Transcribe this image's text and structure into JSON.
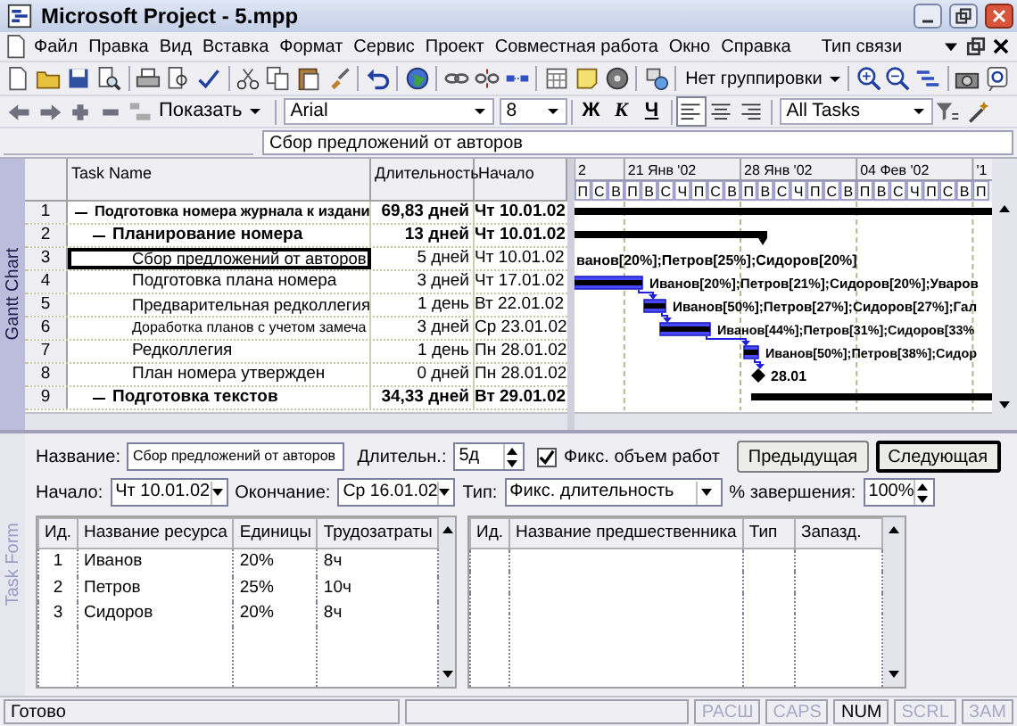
{
  "window": {
    "title": "Microsoft Project - 5.mpp"
  },
  "menu": {
    "items": [
      {
        "label": "Файл"
      },
      {
        "label": "Правка"
      },
      {
        "label": "Вид"
      },
      {
        "label": "Вставка"
      },
      {
        "label": "Формат"
      },
      {
        "label": "Сервис"
      },
      {
        "label": "Проект"
      },
      {
        "label": "Совместная работа"
      },
      {
        "label": "Окно"
      },
      {
        "label": "Справка"
      }
    ],
    "hint": "Тип связи"
  },
  "toolbar": {
    "grouping": "Нет группировки",
    "show": "Показать",
    "font": "Arial",
    "font_size": "8",
    "bold": "Ж",
    "italic": "К",
    "underline": "Ч",
    "align": [
      {
        "selected": true
      },
      {
        "selected": false
      },
      {
        "selected": false
      }
    ],
    "filter": "All Tasks"
  },
  "entry_bar": {
    "value": "Сбор предложений от авторов"
  },
  "gantt": {
    "view_label": "Gantt Chart",
    "columns": [
      "Task Name",
      "Длительность",
      "Начало"
    ],
    "timescale": {
      "weeks": [
        "2",
        "21 Янв '02",
        "28 Янв '02",
        "04 Фев '02",
        "'1"
      ],
      "days": [
        "П",
        "С",
        "В",
        "П",
        "В",
        "С",
        "Ч",
        "П",
        "С",
        "В",
        "П",
        "В",
        "С",
        "Ч",
        "П",
        "С",
        "В",
        "П",
        "В",
        "С",
        "Ч",
        "П",
        "С",
        "В",
        "П"
      ]
    },
    "tasks": [
      {
        "id": "1",
        "name": "Подготовка номера журнала к издани",
        "duration": "69,83 дней",
        "start": "Чт 10.01.02",
        "kind": "summary",
        "expanded": true,
        "selected": false,
        "children": [
          {
            "id": "2",
            "name": "Планирование номера",
            "duration": "13 дней",
            "start": "Чт 10.01.02",
            "kind": "summary",
            "expanded": true,
            "selected": false,
            "children": [
              {
                "id": "3",
                "name": "Сбор предложений от авторов",
                "duration": "5 дней",
                "start": "Чт 10.01.02",
                "kind": "task",
                "selected": true,
                "bar_label": "ванов[20%];Петров[25%];Сидоров[20%]"
              },
              {
                "id": "4",
                "name": "Подготовка плана номера",
                "duration": "3 дней",
                "start": "Чт 17.01.02",
                "kind": "task",
                "selected": false,
                "bar_label": "Иванов[20%];Петров[21%];Сидоров[20%];Уваров"
              },
              {
                "id": "5",
                "name": "Предварительная редколлегия",
                "duration": "1 день",
                "start": "Вт 22.01.02",
                "kind": "task",
                "selected": false,
                "bar_label": "Иванов[50%];Петров[27%];Сидоров[27%];Гал"
              },
              {
                "id": "6",
                "name": "Доработка планов с учетом замеча",
                "duration": "3 дней",
                "start": "Ср 23.01.02",
                "kind": "task",
                "selected": false,
                "bar_label": "Иванов[44%];Петров[31%];Сидоров[33%"
              },
              {
                "id": "7",
                "name": "Редколлегия",
                "duration": "1 день",
                "start": "Пн 28.01.02",
                "kind": "task",
                "selected": false,
                "bar_label": "Иванов[50%];Петров[38%];Сидор"
              },
              {
                "id": "8",
                "name": "План номера утвержден",
                "duration": "0 дней",
                "start": "Пн 28.01.02",
                "kind": "milestone",
                "selected": false,
                "bar_label": "28.01"
              }
            ]
          },
          {
            "id": "9",
            "name": "Подготовка текстов",
            "duration": "34,33 дней",
            "start": "Вт 29.01.02",
            "kind": "summary",
            "expanded": true,
            "selected": false
          }
        ]
      }
    ]
  },
  "task_form": {
    "view_label": "Task Form",
    "name_label": "Название:",
    "name_value": "Сбор предложений от авторов",
    "duration_label": "Длительн.:",
    "duration_value": "5д",
    "effort_driven": {
      "label": "Фикс. объем работ",
      "checked": true
    },
    "buttons": [
      {
        "label": "Предыдущая",
        "default": false
      },
      {
        "label": "Следующая",
        "default": true
      }
    ],
    "start_label": "Начало:",
    "start_value": "Чт 10.01.02",
    "finish_label": "Окончание:",
    "finish_value": "Ср 16.01.02",
    "type_label": "Тип:",
    "type_value": "Фикс. длительность",
    "complete_label": "% завершения:",
    "complete_value": "100%",
    "resources": {
      "columns": [
        "Ид.",
        "Название ресурса",
        "Единицы",
        "Трудозатраты"
      ],
      "rows": [
        [
          "1",
          "Иванов",
          "20%",
          "8ч"
        ],
        [
          "2",
          "Петров",
          "25%",
          "10ч"
        ],
        [
          "3",
          "Сидоров",
          "20%",
          "8ч"
        ]
      ]
    },
    "predecessors": {
      "columns": [
        "Ид.",
        "Название предшественника",
        "Тип",
        "Запазд."
      ]
    }
  },
  "status_bar": {
    "text": "Готово",
    "indicators": [
      {
        "label": "РАСШ",
        "on": false
      },
      {
        "label": "CAPS",
        "on": false
      },
      {
        "label": "NUM",
        "on": true
      },
      {
        "label": "SCRL",
        "on": false
      },
      {
        "label": "ЗАМ",
        "on": false
      }
    ]
  }
}
